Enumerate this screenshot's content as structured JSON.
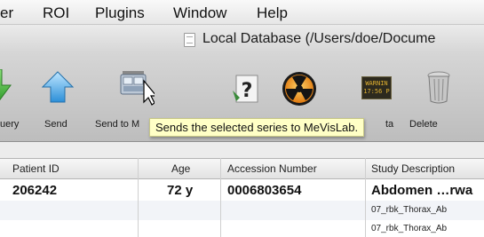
{
  "menubar": {
    "items": [
      "er",
      "ROI",
      "Plugins",
      "Window",
      "Help"
    ]
  },
  "window": {
    "title": "Local Database (/Users/doe/Docume"
  },
  "toolbar": {
    "query_label": "uery",
    "send_label": "Send",
    "send_to_label": "Send to M",
    "meta_data_label": "ta",
    "delete_label": "Delete",
    "mevis_icon_text_line1": "WARNIN",
    "mevis_icon_text_line2": "17:56 P"
  },
  "tooltip": {
    "text": "Sends the selected series to MeVisLab."
  },
  "table": {
    "headers": [
      "Patient ID",
      "Age",
      "Accession Number",
      "Study Description"
    ],
    "rows": [
      {
        "patient_id": "206242",
        "age": "72 y",
        "accession_number": "0006803654",
        "study_description": "Abdomen …rwa"
      }
    ],
    "series_rows": [
      "07_rbk_Thorax_Ab",
      "07_rbk_Thorax_Ab"
    ]
  },
  "colors": {
    "tooltip_background": "#ffffc6",
    "toolbar_background": "#c9c9c9",
    "row_alternate": "#f2f4f8"
  }
}
